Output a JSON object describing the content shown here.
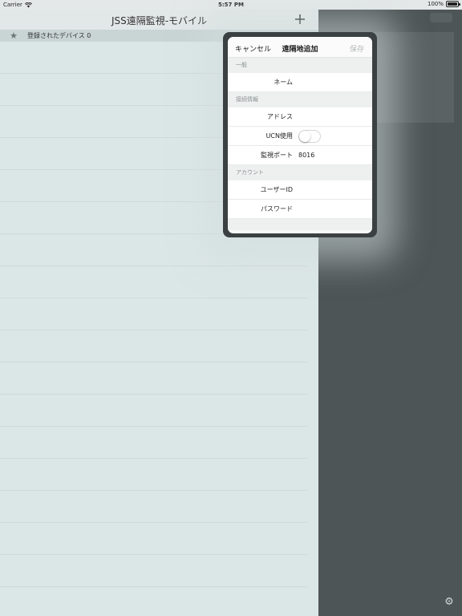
{
  "status_bar": {
    "carrier": "Carrier",
    "time": "5:57 PM",
    "battery": "100%",
    "battery_level": 1.0
  },
  "master": {
    "title": "JSS遠隔監視-モバイル",
    "add_icon": "plus-icon",
    "device_header": "登録されたデバイス 0"
  },
  "detail": {
    "settings_icon": "gear-icon"
  },
  "popover": {
    "cancel": "キャンセル",
    "title": "遠隔地追加",
    "save": "保存",
    "sections": {
      "general": "一般",
      "connection": "接続情報",
      "account": "アカウント"
    },
    "fields": {
      "name": {
        "label": "ネーム",
        "value": ""
      },
      "address": {
        "label": "アドレス",
        "value": ""
      },
      "ucn": {
        "label": "UCN使用",
        "on": false
      },
      "port": {
        "label": "監視ポート",
        "value": "8016"
      },
      "user_id": {
        "label": "ユーザーID",
        "value": ""
      },
      "password": {
        "label": "パスワード",
        "value": ""
      }
    }
  },
  "colors": {
    "accent": "#333333",
    "master_bg": "#dbe6e6",
    "detail_bg": "#4e5557"
  }
}
